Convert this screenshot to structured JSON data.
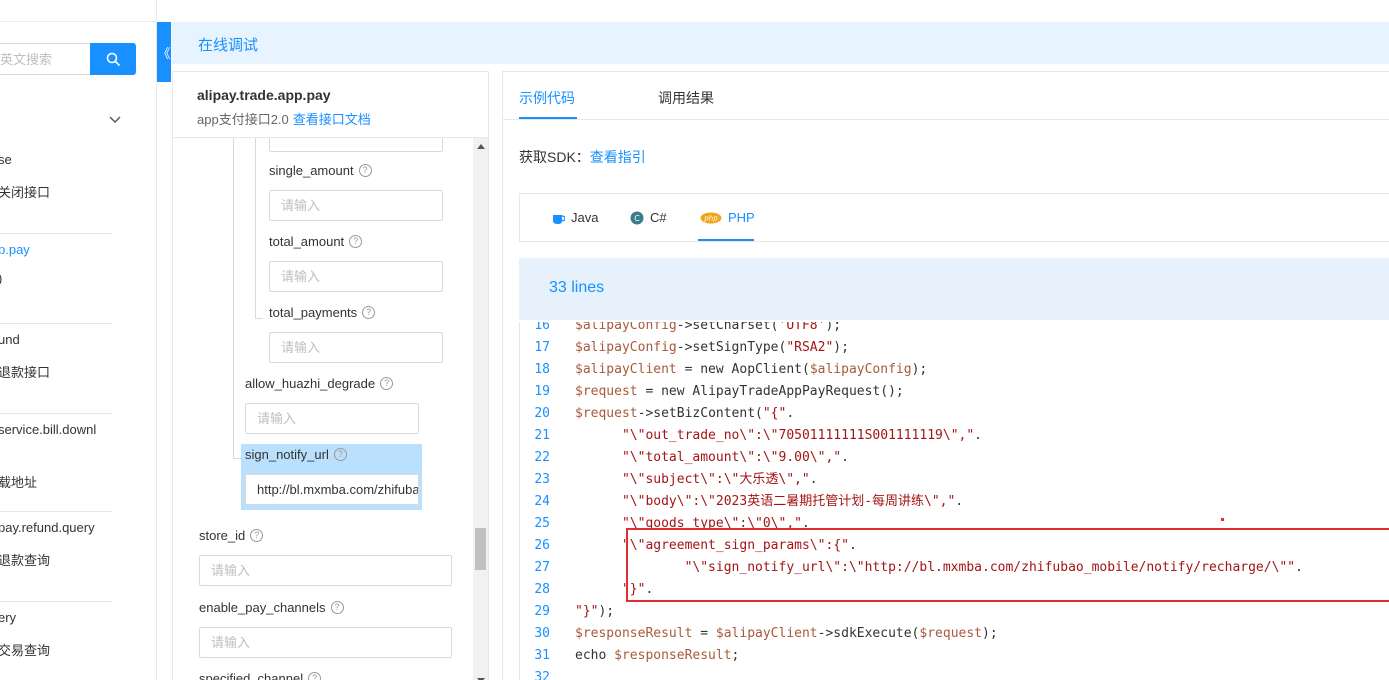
{
  "sidebar": {
    "search_placeholder": "中英文搜索",
    "items": [
      {
        "label": "se",
        "active": false
      },
      {
        "label": "关闭接口",
        "active": false
      },
      {
        "label": "p.pay",
        "active": true
      },
      {
        "label": ")",
        "active": false
      },
      {
        "label": "und",
        "active": false
      },
      {
        "label": "退款接口",
        "active": false
      },
      {
        "label": "service.bill.downl",
        "active": false
      },
      {
        "label": "载地址",
        "active": false
      },
      {
        "label": "pay.refund.query",
        "active": false
      },
      {
        "label": "退款查询",
        "active": false
      },
      {
        "label": "ery",
        "active": false
      },
      {
        "label": "交易查询",
        "active": false
      }
    ]
  },
  "collapse_tab": {
    "glyph": "《"
  },
  "header": {
    "title": "在线调试"
  },
  "api": {
    "name": "alipay.trade.app.pay",
    "desc": "app支付接口2.0",
    "doc_link": "查看接口文档"
  },
  "params": [
    {
      "name": "single_amount",
      "placeholder": "请输入",
      "value": ""
    },
    {
      "name": "total_amount",
      "placeholder": "请输入",
      "value": ""
    },
    {
      "name": "total_payments",
      "placeholder": "请输入",
      "value": ""
    },
    {
      "name": "allow_huazhi_degrade",
      "placeholder": "请输入",
      "value": ""
    },
    {
      "name": "sign_notify_url",
      "placeholder": "请输入",
      "value": "http://bl.mxmba.com/zhifubao_mobile/notify/recharge/"
    },
    {
      "name": "store_id",
      "placeholder": "请输入",
      "value": ""
    },
    {
      "name": "enable_pay_channels",
      "placeholder": "请输入",
      "value": ""
    },
    {
      "name": "specified_channel",
      "placeholder": "",
      "value": ""
    }
  ],
  "help_glyph": "?",
  "code_panel": {
    "tabs": [
      "示例代码",
      "调用结果"
    ],
    "active_tab": "示例代码",
    "sdk_label": "获取SDK：",
    "sdk_link": "查看指引",
    "languages": [
      "Java",
      "C#",
      "PHP"
    ],
    "active_language": "PHP",
    "lines_count": "33 lines",
    "code_lines": [
      {
        "n": "16",
        "text": "$alipayConfig->setCharset('UTF8');"
      },
      {
        "n": "17",
        "text": "$alipayConfig->setSignType(\"RSA2\");"
      },
      {
        "n": "18",
        "text": "$alipayClient = new AopClient($alipayConfig);"
      },
      {
        "n": "19",
        "text": "$request = new AlipayTradeAppPayRequest();"
      },
      {
        "n": "20",
        "text": "$request->setBizContent(\"{\"."
      },
      {
        "n": "21",
        "text": "      \"\\\"out_trade_no\\\":\\\"70501111111S001111119\\\",\"."
      },
      {
        "n": "22",
        "text": "      \"\\\"total_amount\\\":\\\"9.00\\\",\"."
      },
      {
        "n": "23",
        "text": "      \"\\\"subject\\\":\\\"大乐透\\\",\"."
      },
      {
        "n": "24",
        "text": "      \"\\\"body\\\":\\\"2023英语二暑期托管计划-每周讲练\\\",\"."
      },
      {
        "n": "25",
        "text": "      \"\\\"goods_type\\\":\\\"0\\\",\"."
      },
      {
        "n": "26",
        "text": "      \"\\\"agreement_sign_params\\\":{\"."
      },
      {
        "n": "27",
        "text": "              \"\\\"sign_notify_url\\\":\\\"http://bl.mxmba.com/zhifubao_mobile/notify/recharge/\\\"\"."
      },
      {
        "n": "28",
        "text": "      \"}\"."
      },
      {
        "n": "29",
        "text": "\"}\");"
      },
      {
        "n": "30",
        "text": "$responseResult = $alipayClient->sdkExecute($request);"
      },
      {
        "n": "31",
        "text": "echo $responseResult;"
      },
      {
        "n": "32",
        "text": ""
      }
    ]
  },
  "colors": {
    "accent": "#1890ff",
    "header_bg": "#e7f3fe",
    "highlight_bg": "#bae0fd",
    "annotation_red": "#e03030"
  }
}
